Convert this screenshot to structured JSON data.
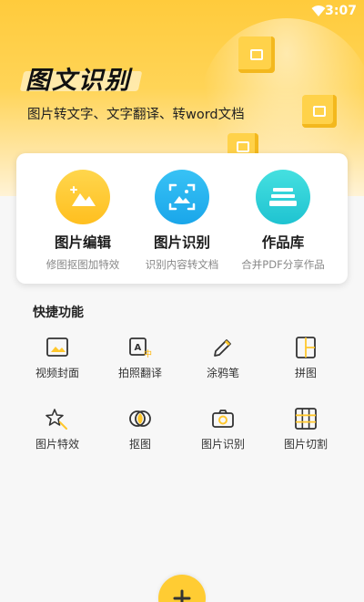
{
  "status_bar": {
    "time": "3:07"
  },
  "header": {
    "title": "图文识别",
    "subtitle": "图片转文字、文字翻译、转word文档"
  },
  "features": [
    {
      "title": "图片编辑",
      "desc": "修图抠图加特效",
      "icon": "mountain-edit-icon",
      "color": "#ffc72c"
    },
    {
      "title": "图片识别",
      "desc": "识别内容转文档",
      "icon": "scan-image-icon",
      "color": "#28b4ef"
    },
    {
      "title": "作品库",
      "desc": "合并PDF分享作品",
      "icon": "stack-icon",
      "color": "#2fd3d9"
    }
  ],
  "quick": {
    "title": "快捷功能",
    "tools": [
      {
        "label": "视频封面",
        "icon": "video-cover-icon"
      },
      {
        "label": "拍照翻译",
        "icon": "translate-icon"
      },
      {
        "label": "涂鸦笔",
        "icon": "pencil-icon"
      },
      {
        "label": "拼图",
        "icon": "collage-icon"
      },
      {
        "label": "图片特效",
        "icon": "star-effect-icon"
      },
      {
        "label": "抠图",
        "icon": "cutout-icon"
      },
      {
        "label": "图片识别",
        "icon": "camera-icon"
      },
      {
        "label": "图片切割",
        "icon": "grid-cut-icon"
      }
    ]
  },
  "fab": {
    "icon": "plus-icon"
  },
  "colors": {
    "accent": "#ffc72c",
    "blue": "#28b4ef",
    "cyan": "#2fd3d9"
  }
}
